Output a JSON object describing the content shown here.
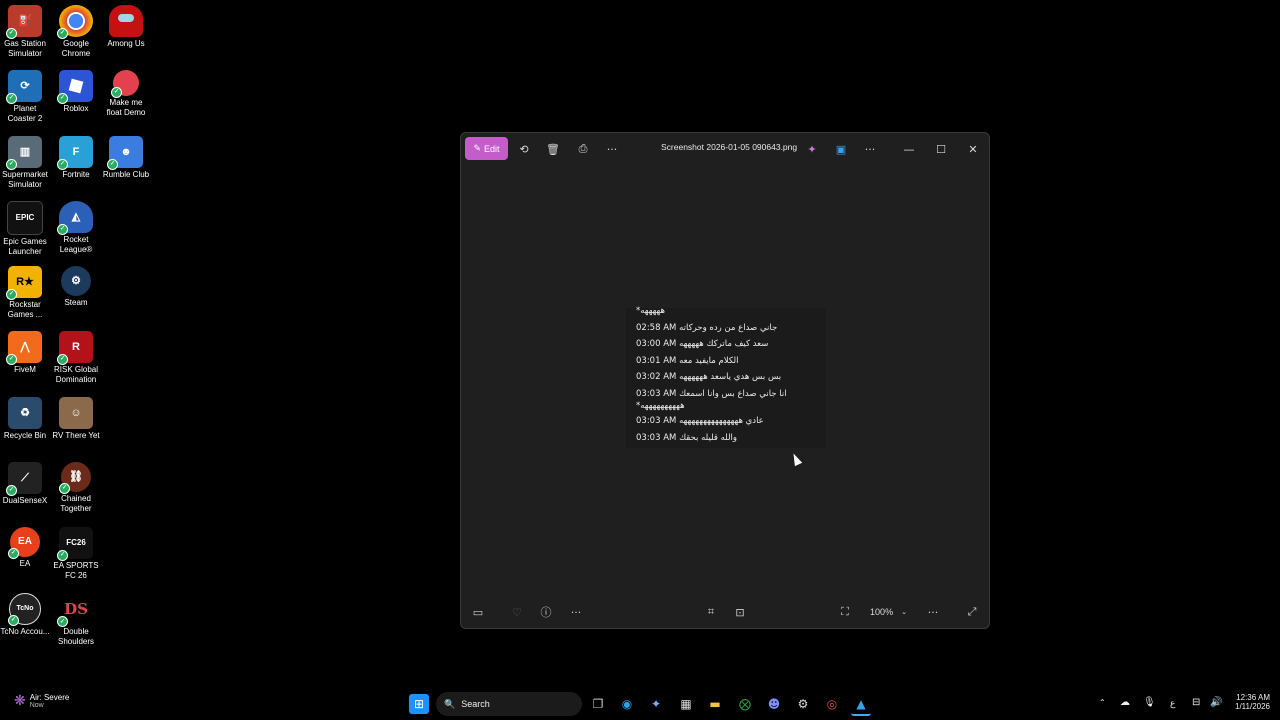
{
  "desktop": {
    "icons": [
      {
        "label": "Gas Station Simulator",
        "icon": "gas-station-icon",
        "color": "#b83b2b"
      },
      {
        "label": "Google Chrome",
        "icon": "chrome-icon",
        "color": "#ffffff"
      },
      {
        "label": "Among Us",
        "icon": "among-us-icon",
        "color": "#c51111"
      },
      {
        "label": "Planet Coaster 2",
        "icon": "planet-coaster-icon",
        "color": "#1f6fb6"
      },
      {
        "label": "Roblox",
        "icon": "roblox-icon",
        "color": "#2c55d6"
      },
      {
        "label": "Make me float Demo",
        "icon": "balloon-icon",
        "color": "#e4414f"
      },
      {
        "label": "Supermarket Simulator",
        "icon": "supermarket-icon",
        "color": "#5a6b78"
      },
      {
        "label": "Fortnite",
        "icon": "fortnite-icon",
        "color": "#2aa0d8"
      },
      {
        "label": "Rumble Club",
        "icon": "rumble-club-icon",
        "color": "#3a7ce0"
      },
      {
        "label": "Epic Games Launcher",
        "icon": "epic-games-icon",
        "color": "#111111"
      },
      {
        "label": "Rocket League®",
        "icon": "rocket-league-icon",
        "color": "#2b5fb8"
      },
      {
        "label": "Rockstar Games ...",
        "icon": "rockstar-icon",
        "color": "#f2b300"
      },
      {
        "label": "Steam",
        "icon": "steam-icon",
        "color": "#1b3a5c"
      },
      {
        "label": "FiveM",
        "icon": "fivem-icon",
        "color": "#f26b1d"
      },
      {
        "label": "RISK Global Domination",
        "icon": "risk-icon",
        "color": "#b3121a"
      },
      {
        "label": "Recycle Bin",
        "icon": "recycle-bin-icon",
        "color": "#2a4b6b"
      },
      {
        "label": "RV There Yet",
        "icon": "rv-there-yet-icon",
        "color": "#8a6a4a"
      },
      {
        "label": "DualSenseX",
        "icon": "dualsensex-icon",
        "color": "#222222"
      },
      {
        "label": "Chained Together",
        "icon": "chained-together-icon",
        "color": "#6b2a1a"
      },
      {
        "label": "EA",
        "icon": "ea-icon",
        "color": "#e8401c"
      },
      {
        "label": "EA SPORTS FC 26",
        "icon": "ea-sports-fc-icon",
        "color": "#111111"
      },
      {
        "label": "TcNo Accou...",
        "icon": "tcno-icon",
        "color": "#222222"
      },
      {
        "label": "Double Shoulders",
        "icon": "double-shoulders-icon",
        "color": "#000000"
      }
    ]
  },
  "photos_window": {
    "edit_label": "Edit",
    "file_title": "Screenshot 2026-01-05 090643.png",
    "zoom_label": "100%",
    "image_messages": [
      {
        "time": "",
        "text": "*هههههه"
      },
      {
        "time": "02:58 AM",
        "text": "جاني صداع من رده وحركاته"
      },
      {
        "time": "03:00 AM",
        "text": "سعد كيف ماتركك هههههه"
      },
      {
        "time": "03:01 AM",
        "text": "الكلام مايفيد معه"
      },
      {
        "time": "03:02 AM",
        "text": "بس بس هدي ياسعد ههههههه"
      },
      {
        "time": "03:03 AM",
        "text": "انا جاني صداع بس وانا اسمعك"
      },
      {
        "time": "",
        "text": "*ههههههههههه"
      },
      {
        "time": "03:03 AM",
        "text": "عادي هههههههههههههههه"
      },
      {
        "time": "03:03 AM",
        "text": "والله قليله بحقك"
      }
    ]
  },
  "taskbar": {
    "weather_title": "Air: Severe",
    "weather_sub": "Now",
    "search_label": "Search",
    "time": "12:36 AM",
    "date": "1/11/2026",
    "lang": "ع"
  }
}
